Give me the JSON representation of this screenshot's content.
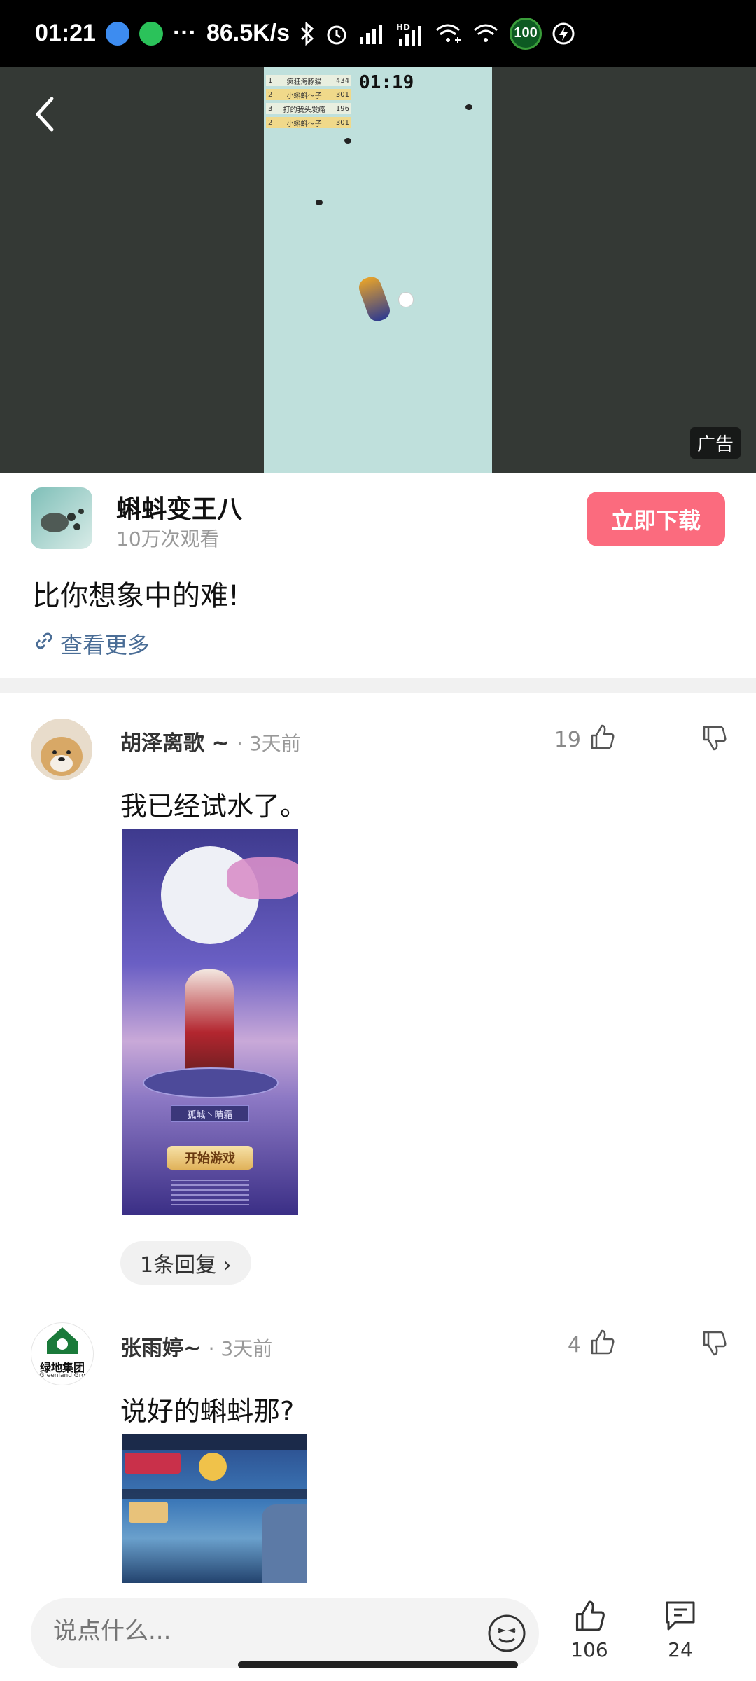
{
  "status_bar": {
    "time": "01:21",
    "dots": "···",
    "net_speed": "86.5K/s",
    "battery": "100",
    "colors": {
      "app1": "#3d8cf0",
      "app2": "#2bc25a"
    }
  },
  "video": {
    "timer": "01:19",
    "ad_label": "广告",
    "leaderboard": [
      {
        "rank": "1",
        "name": "疯狂海豚猫",
        "score": "434"
      },
      {
        "rank": "2",
        "name": "小蝌蚪～子",
        "score": "301"
      },
      {
        "rank": "3",
        "name": "打的我头发痛",
        "score": "196"
      },
      {
        "rank": "2",
        "name": "小蝌蚪～子",
        "score": "301"
      }
    ]
  },
  "app": {
    "name": "蝌蚪变王八",
    "views": "10万次观看",
    "download_label": "立即下载",
    "brand_color": "#fb6b7e"
  },
  "post": {
    "title": "比你想象中的难!",
    "see_more": "查看更多"
  },
  "comments": [
    {
      "user": "胡泽离歌 ~",
      "time": "· 3天前",
      "likes": "19",
      "text": "我已经试水了。",
      "image": {
        "button": "开始游戏",
        "name_tag": "孤城丶晴霜"
      },
      "replies": "1条回复 ›"
    },
    {
      "user": "张雨婷~",
      "time": "· 3天前",
      "likes": "4",
      "text": "说好的蝌蚪那?",
      "avatar_text": "绿地集团",
      "avatar_sub": "Greenland Gro"
    }
  ],
  "bottom": {
    "input_placeholder": "说点什么...",
    "likes_count": "106",
    "comments_count": "24"
  }
}
